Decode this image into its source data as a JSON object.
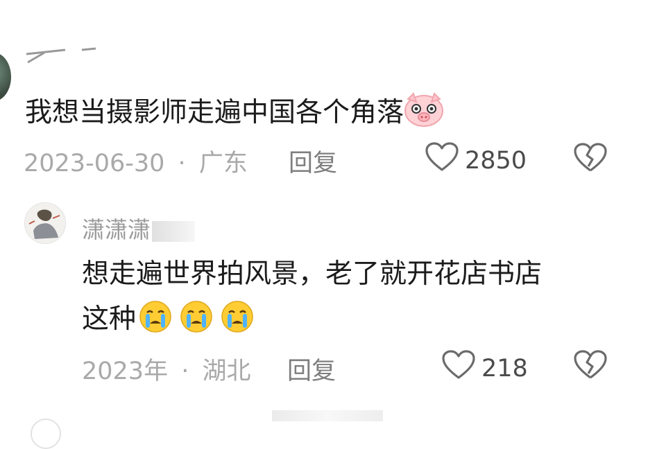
{
  "comments": [
    {
      "text": "我想当摄影师走遍中国各个角落",
      "emoji": "pig-face-emoji",
      "date": "2023-06-30",
      "location": "广东",
      "reply_label": "回复",
      "likes": "2850"
    },
    {
      "username": "潇潇潇",
      "text_line1": "想走遍世界拍风景，老了就开花店书店",
      "text_line2": "这种",
      "emoji": "crying-face-emoji",
      "date": "2023年",
      "location": "湖北",
      "reply_label": "回复",
      "likes": "218"
    }
  ],
  "separator": "·",
  "colors": {
    "text": "#1b1b1b",
    "meta": "#a9a9a9",
    "icon": "#6b6b6b"
  }
}
